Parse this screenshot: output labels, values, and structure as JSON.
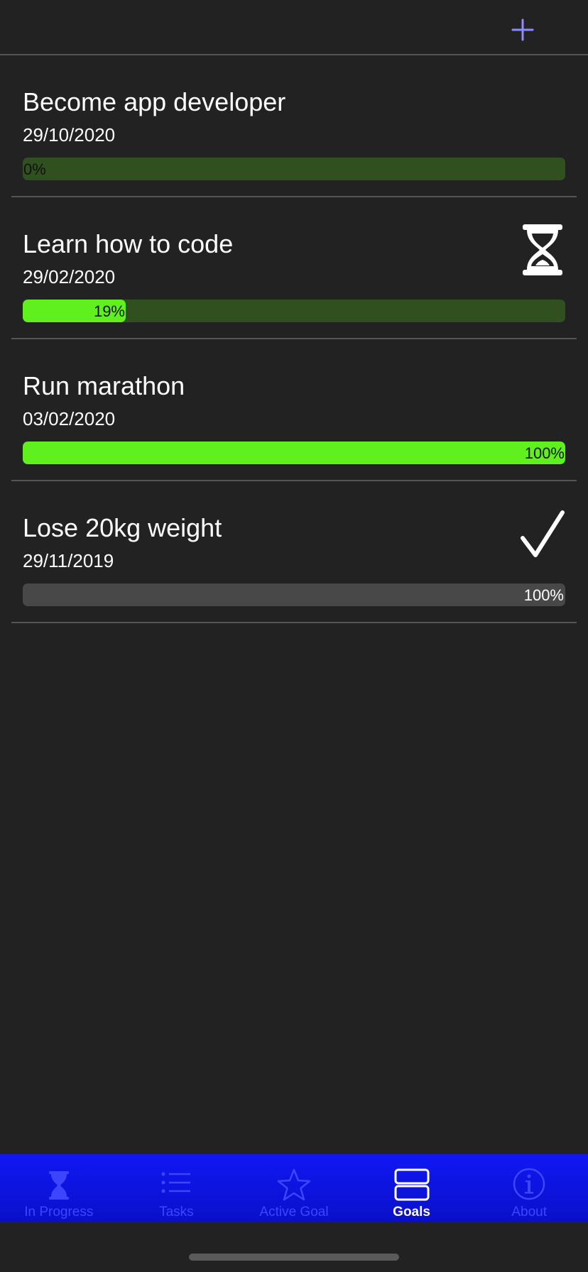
{
  "colors": {
    "background": "#222222",
    "divider": "#555555",
    "accent": "#8c8cff",
    "progress_fill": "#5ff01e",
    "progress_track": "#31501f",
    "progress_track_done": "#484848",
    "tab_bar": "#0f18f5",
    "tab_inactive": "#3d45ff",
    "tab_active": "#ffffff"
  },
  "toolbar": {
    "add_icon": "plus-icon"
  },
  "goals": [
    {
      "title": "Become app developer",
      "date": "29/10/2020",
      "progress": 0,
      "progress_label": "0%",
      "status_icon": "none",
      "completed": false
    },
    {
      "title": "Learn how to code",
      "date": "29/02/2020",
      "progress": 19,
      "progress_label": "19%",
      "status_icon": "hourglass-icon",
      "completed": false
    },
    {
      "title": "Run marathon",
      "date": "03/02/2020",
      "progress": 100,
      "progress_label": "100%",
      "status_icon": "none",
      "completed": false
    },
    {
      "title": "Lose 20kg weight",
      "date": "29/11/2019",
      "progress": 100,
      "progress_label": "100%",
      "status_icon": "checkmark-icon",
      "completed": true
    }
  ],
  "tabs": [
    {
      "label": "In Progress",
      "icon": "hourglass-icon",
      "active": false
    },
    {
      "label": "Tasks",
      "icon": "list-icon",
      "active": false
    },
    {
      "label": "Active Goal",
      "icon": "star-icon",
      "active": false
    },
    {
      "label": "Goals",
      "icon": "stacked-rows-icon",
      "active": true
    },
    {
      "label": "About",
      "icon": "info-icon",
      "active": false
    }
  ]
}
